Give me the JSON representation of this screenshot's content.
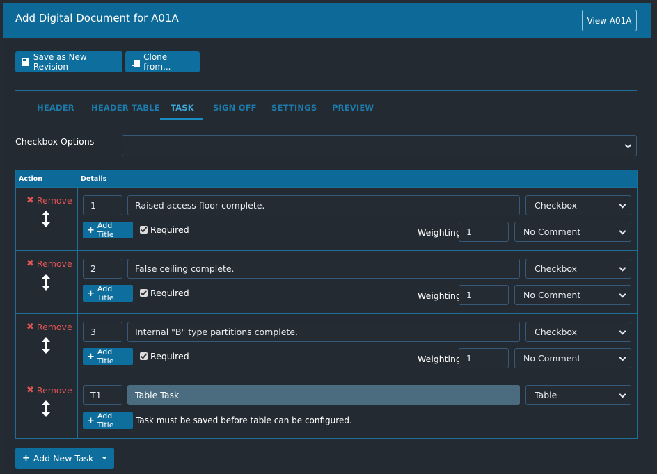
{
  "header": {
    "title": "Add Digital Document for A01A",
    "view_button": "View A01A"
  },
  "toolbar": {
    "save_label": "Save as New Revision",
    "clone_label": "Clone from..."
  },
  "tabs": [
    {
      "label": "HEADER",
      "active": false
    },
    {
      "label": "HEADER TABLE",
      "active": false
    },
    {
      "label": "TASK",
      "active": true
    },
    {
      "label": "SIGN OFF",
      "active": false
    },
    {
      "label": "SETTINGS",
      "active": false
    },
    {
      "label": "PREVIEW",
      "active": false
    }
  ],
  "checkbox_options": {
    "label": "Checkbox Options",
    "value": ""
  },
  "table": {
    "col_action": "Action",
    "col_details": "Details",
    "remove_label": "Remove",
    "add_title_label": "Add Title",
    "required_label": "Required",
    "weighting_label": "Weighting",
    "rows": [
      {
        "number": "1",
        "text": "Raised access floor complete.",
        "type": "Checkbox",
        "required": true,
        "weighting": "1",
        "comment": "No Comment"
      },
      {
        "number": "2",
        "text": "False ceiling complete.",
        "type": "Checkbox",
        "required": true,
        "weighting": "1",
        "comment": "No Comment"
      },
      {
        "number": "3",
        "text": "Internal \"B\" type partitions complete.",
        "type": "Checkbox",
        "required": true,
        "weighting": "1",
        "comment": "No Comment"
      },
      {
        "number": "T1",
        "text": "Table Task",
        "type": "Table",
        "note": "Task must be saved before table can be configured."
      }
    ]
  },
  "add_new_task": "Add New Task",
  "colors": {
    "background": "#252b33",
    "header": "#0d6a98",
    "button": "#0e6f9e",
    "remove": "#e15555",
    "tab": "#1c7bab",
    "tab_active": "#3aa7d8"
  }
}
